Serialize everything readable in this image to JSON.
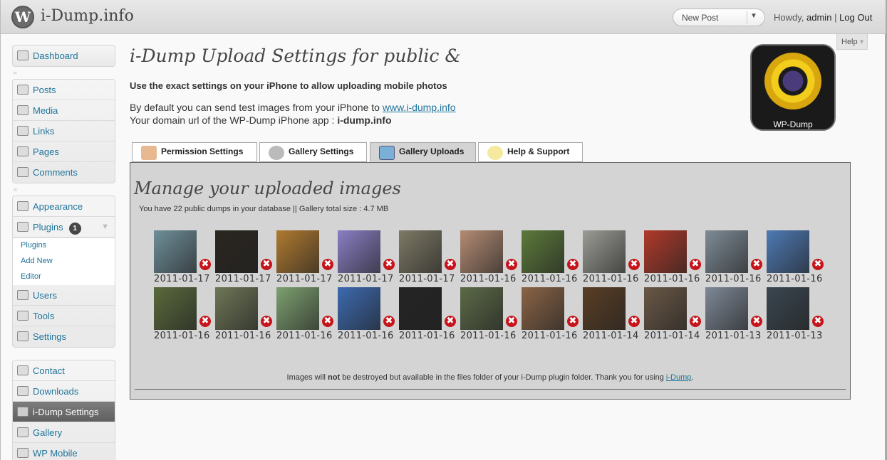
{
  "header": {
    "site_title": "i-Dump.info",
    "new_post": "New Post",
    "howdy": "Howdy,",
    "user": "admin",
    "separator": "|",
    "logout": "Log Out",
    "help": "Help"
  },
  "menu": {
    "dashboard": "Dashboard",
    "posts": "Posts",
    "media": "Media",
    "links": "Links",
    "pages": "Pages",
    "comments": "Comments",
    "appearance": "Appearance",
    "plugins": "Plugins",
    "plugins_badge": "1",
    "plugins_sub": [
      "Plugins",
      "Add New",
      "Editor"
    ],
    "users": "Users",
    "tools": "Tools",
    "settings": "Settings",
    "contact": "Contact",
    "downloads": "Downloads",
    "idump_settings": "i-Dump Settings",
    "gallery": "Gallery",
    "wp_mobile": "WP Mobile"
  },
  "page": {
    "title": "i-Dump Upload Settings for public &",
    "intro": "Use the exact settings on your iPhone to allow uploading mobile photos",
    "default_text": "By default you can send test images from your iPhone to",
    "default_link": "www.i-dump.info",
    "domain_text": "Your domain url of the WP-Dump iPhone app :",
    "domain_value": "i-dump.info",
    "app_icon_label": "WP-Dump"
  },
  "tabs": [
    {
      "label": "Permission Settings"
    },
    {
      "label": "Gallery Settings"
    },
    {
      "label": "Gallery Uploads"
    },
    {
      "label": "Help & Support"
    }
  ],
  "panel": {
    "title": "Manage your uploaded images",
    "info": "You have 22 public dumps in your database || Gallery total size : 4.7 MB",
    "footnote_pre": "Images will",
    "footnote_bold": "not",
    "footnote_post": "be destroyed but available in the files folder of your i-Dump plugin folder. Thank you for using",
    "footnote_link": "i-Dump",
    "footnote_end": "."
  },
  "images": [
    {
      "date": "2011-01-17",
      "color": "#6f8f9a"
    },
    {
      "date": "2011-01-17",
      "color": "#2a2620"
    },
    {
      "date": "2011-01-17",
      "color": "#b07a30"
    },
    {
      "date": "2011-01-17",
      "color": "#8a7fc4"
    },
    {
      "date": "2011-01-17",
      "color": "#7e7a66"
    },
    {
      "date": "2011-01-16",
      "color": "#b48c74"
    },
    {
      "date": "2011-01-16",
      "color": "#5c7a3a"
    },
    {
      "date": "2011-01-16",
      "color": "#9c9c96"
    },
    {
      "date": "2011-01-16",
      "color": "#b03a2a"
    },
    {
      "date": "2011-01-16",
      "color": "#7f8c96"
    },
    {
      "date": "2011-01-16",
      "color": "#4e7ab4"
    },
    {
      "date": "2011-01-16",
      "color": "#5a6a3c"
    },
    {
      "date": "2011-01-16",
      "color": "#6e7656"
    },
    {
      "date": "2011-01-16",
      "color": "#7da070"
    },
    {
      "date": "2011-01-16",
      "color": "#3c6ab0"
    },
    {
      "date": "2011-01-16",
      "color": "#242424"
    },
    {
      "date": "2011-01-16",
      "color": "#5c6a48"
    },
    {
      "date": "2011-01-16",
      "color": "#8a6446"
    },
    {
      "date": "2011-01-14",
      "color": "#5a3e24"
    },
    {
      "date": "2011-01-14",
      "color": "#6a5846"
    },
    {
      "date": "2011-01-13",
      "color": "#7e8896"
    },
    {
      "date": "2011-01-13",
      "color": "#3a4650"
    }
  ]
}
